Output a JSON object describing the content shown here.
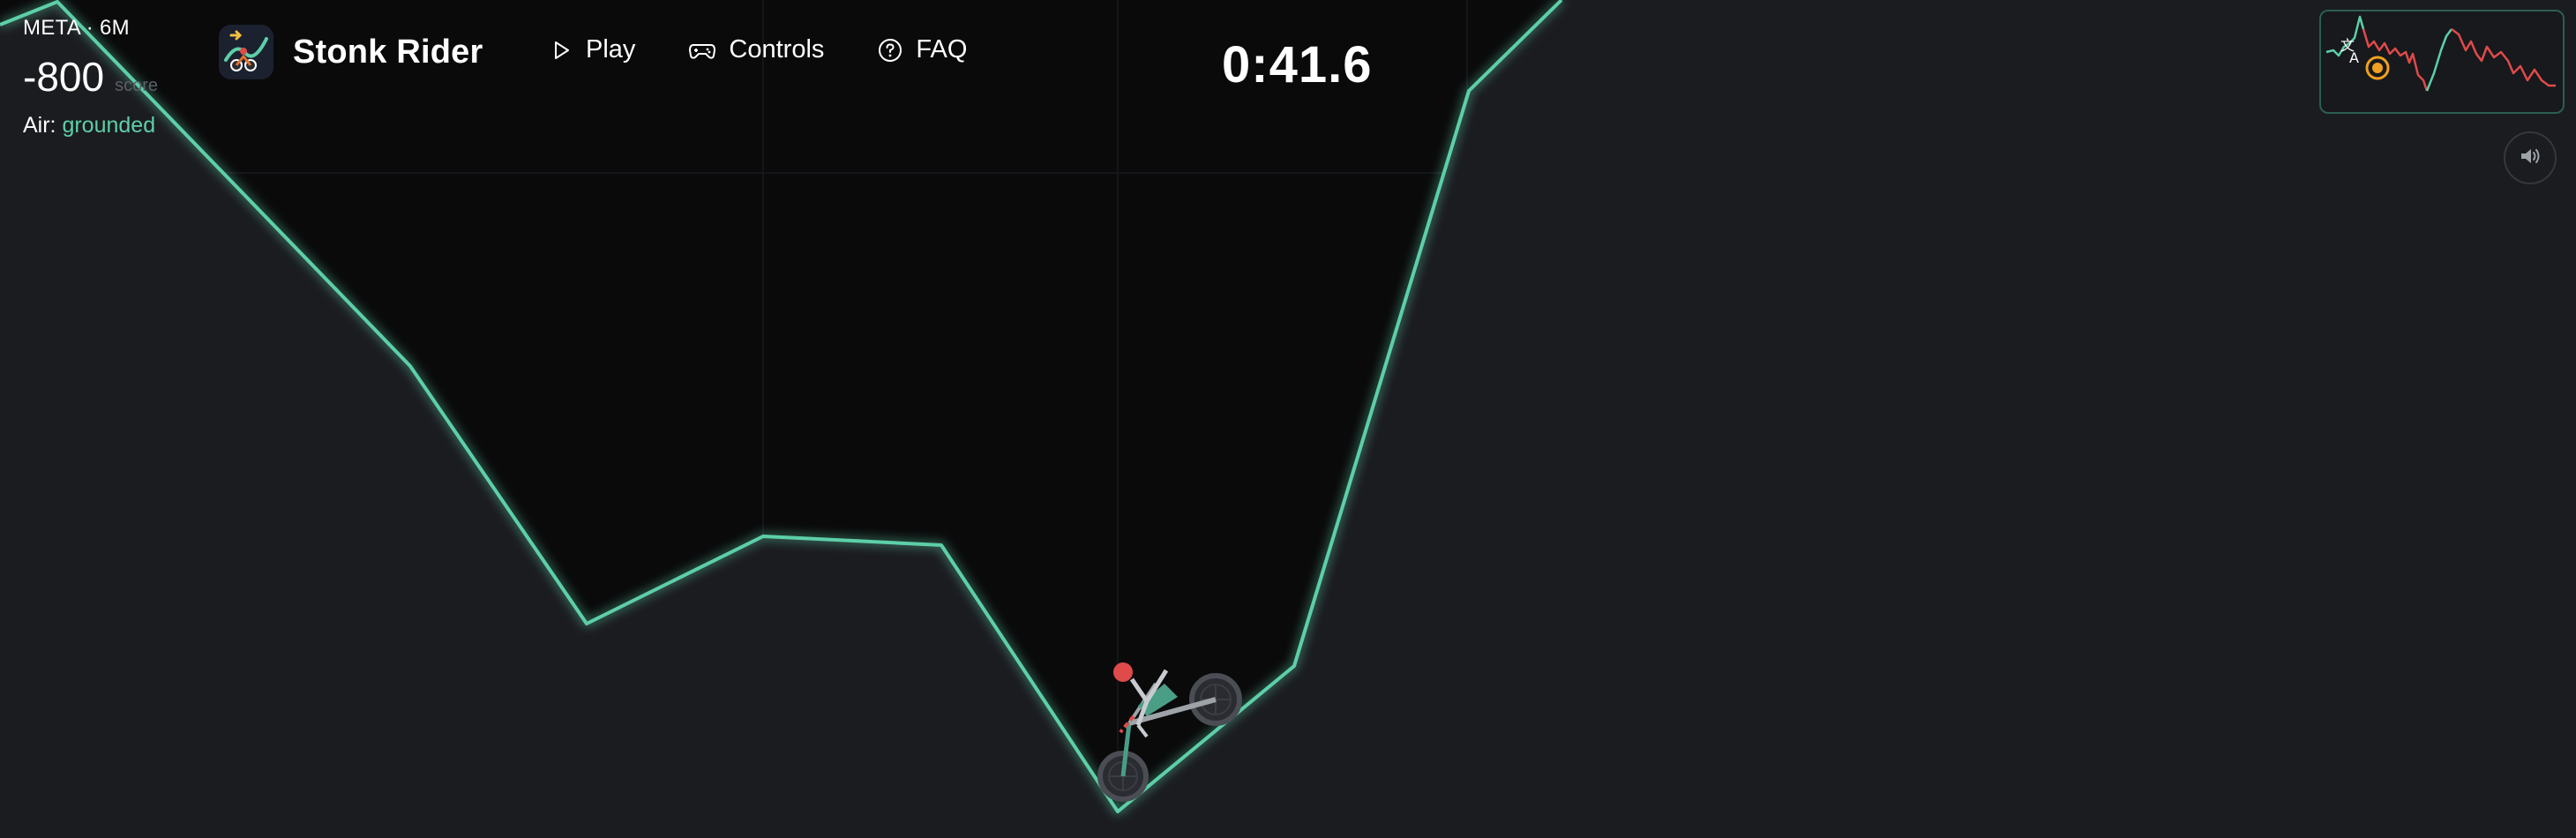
{
  "hud": {
    "ticker": "META · 6M",
    "score": "-800",
    "score_unit": "score",
    "air_label": "Air:",
    "air_state": "grounded",
    "timer": "0:41.6"
  },
  "brand": {
    "name": "Stonk Rider",
    "logo_icon": "rider-chart-logo-icon"
  },
  "nav": {
    "play": "Play",
    "controls": "Controls",
    "faq": "FAQ"
  },
  "icons": {
    "play": "play-icon",
    "controls": "gamepad-icon",
    "faq": "question-circle-icon",
    "sound": "speaker-icon",
    "translate": "translate-icon"
  },
  "colors": {
    "track": "#5dcfa8",
    "ground": "#1b1c20",
    "sky": "#0a0a0b",
    "rider_head": "#e04a4a",
    "minimap_up": "#5dcfa8",
    "minimap_down": "#e04a4a",
    "marker": "#f0a020"
  }
}
